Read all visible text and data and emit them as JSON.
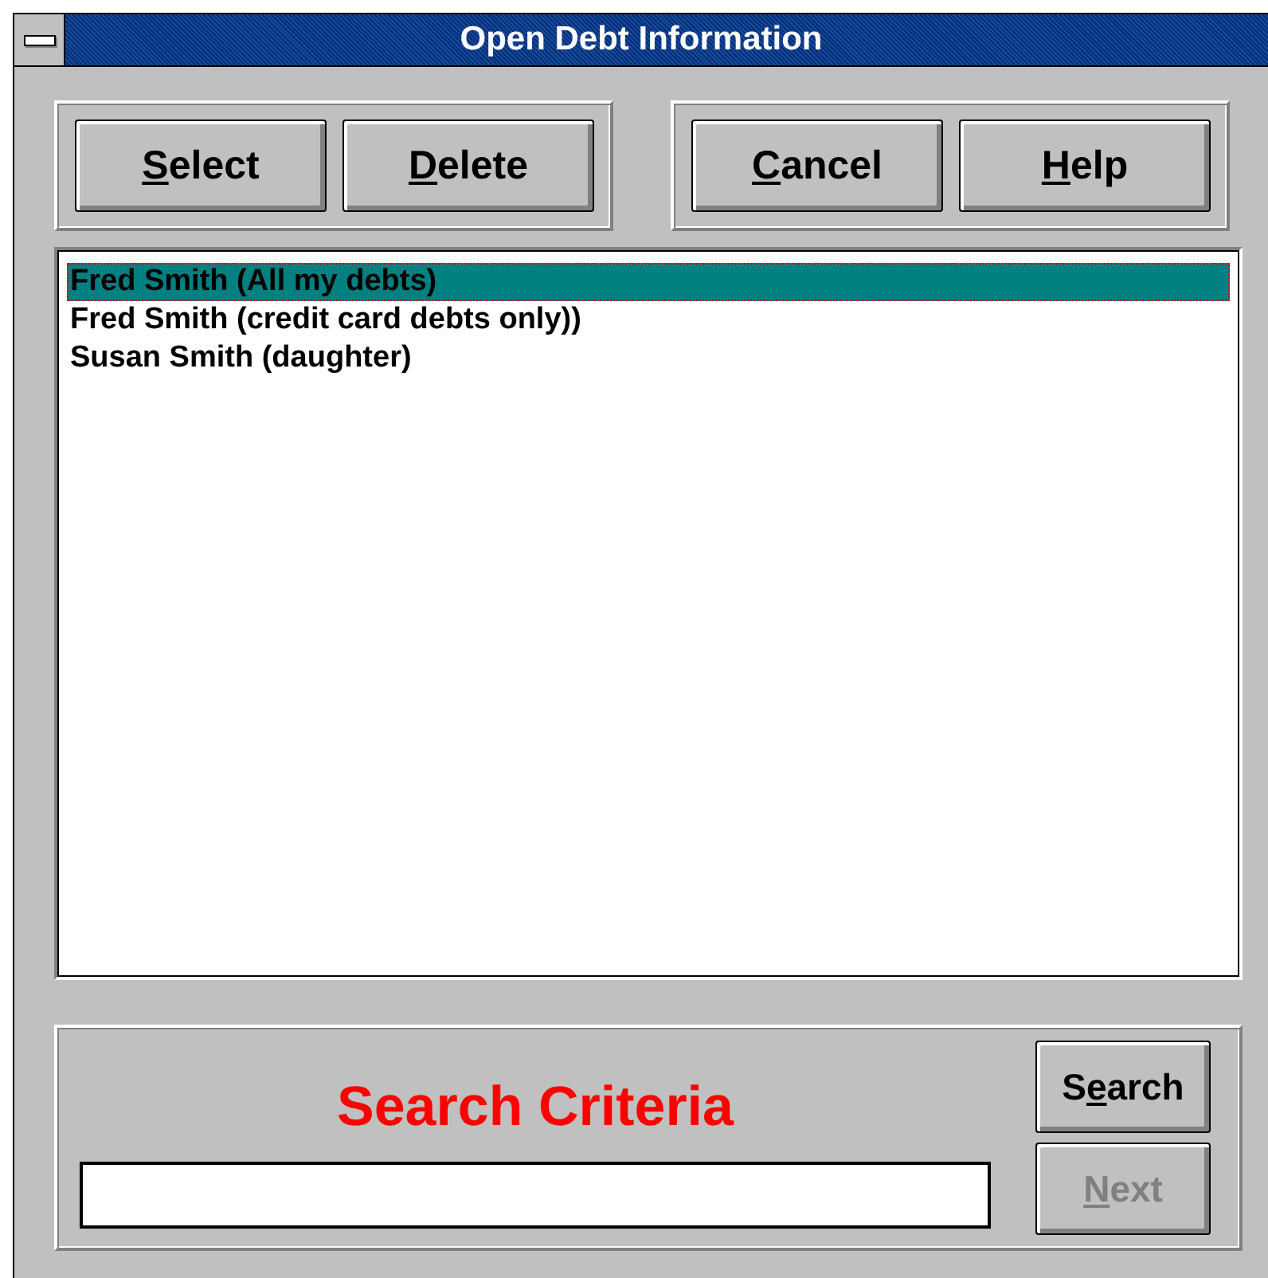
{
  "window": {
    "title": "Open Debt Information"
  },
  "button_groups": [
    [
      {
        "key": "S",
        "rest": "elect"
      },
      {
        "key": "D",
        "rest": "elete"
      }
    ],
    [
      {
        "key": "C",
        "rest": "ancel"
      },
      {
        "key": "H",
        "rest": "elp"
      }
    ]
  ],
  "list": {
    "items": [
      {
        "text": "Fred Smith (All my debts)",
        "selected": true
      },
      {
        "text": "Fred Smith (credit card debts only))",
        "selected": false
      },
      {
        "text": "Susan Smith (daughter)",
        "selected": false
      }
    ]
  },
  "search": {
    "heading": "Search Criteria",
    "buttons": [
      {
        "before": "S",
        "key": "e",
        "rest": "arch",
        "disabled": false
      },
      {
        "key": "N",
        "rest": "ext",
        "disabled": true
      }
    ]
  }
}
